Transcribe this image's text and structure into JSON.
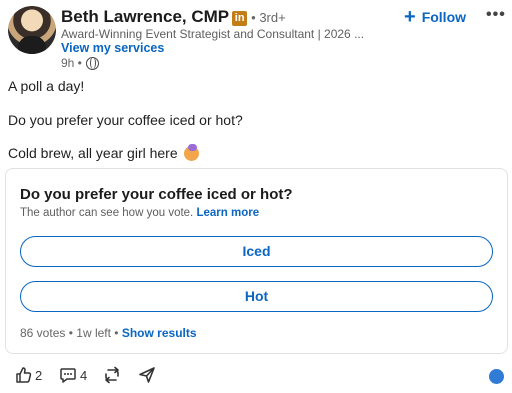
{
  "author": {
    "name": "Beth Lawrence, CMP",
    "badge": "in",
    "degree": "• 3rd+",
    "headline": "Award-Winning Event Strategist and Consultant | 2026 ...",
    "services_link": "View my services",
    "time": "9h •",
    "follow_label": "Follow",
    "more_label": "•••"
  },
  "post": {
    "line1": "A poll a day!",
    "line2": "Do you prefer your coffee iced or hot?",
    "line3": "Cold brew, all year girl here"
  },
  "poll": {
    "question": "Do you prefer your coffee iced or hot?",
    "note": "The author can see how you vote.",
    "learn_more": "Learn more",
    "options": [
      "Iced",
      "Hot"
    ],
    "votes": "86 votes",
    "time_left": "1w left",
    "show_results": "Show results",
    "separator": "•"
  },
  "social": {
    "likes": "2",
    "comments": "4"
  },
  "colors": {
    "accent": "#0a66c2",
    "linkedin_badge": "#c37d16"
  }
}
